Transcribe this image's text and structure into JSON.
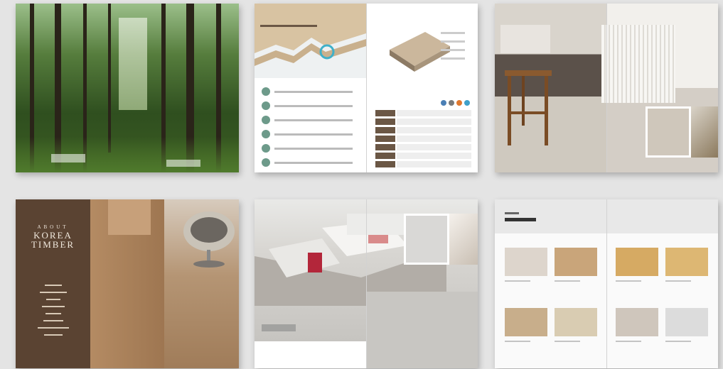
{
  "cover": {
    "brand": "KOREA TIMBER",
    "left_logo_text": "",
    "right_logo_text": ""
  },
  "spread2": {
    "left_label": "",
    "left_title": "",
    "list_items": [
      "",
      "",
      "",
      "",
      "",
      ""
    ],
    "right_label": "",
    "spec_rows": [
      "",
      "",
      "",
      "",
      "",
      "",
      ""
    ]
  },
  "spread3": {
    "label": ""
  },
  "about": {
    "heading_small": "ABOUT",
    "heading_line1": "KOREA",
    "heading_line2": "TIMBER",
    "menu": [
      "",
      "",
      "",
      "",
      "",
      "",
      "",
      ""
    ]
  },
  "spread5": {
    "label": "",
    "title": ""
  },
  "spread6": {
    "label": "",
    "title": "",
    "swatches": [
      {
        "color": "#ddd5cc",
        "caption": ""
      },
      {
        "color": "#c9a57a",
        "caption": ""
      },
      {
        "color": "#d6aa63",
        "caption": ""
      },
      {
        "color": "#ddb773",
        "caption": ""
      },
      {
        "color": "#c8ae8b",
        "caption": ""
      },
      {
        "color": "#d9ccb2",
        "caption": ""
      },
      {
        "color": "#cfc6bc",
        "caption": ""
      },
      {
        "color": "#dcdcdc",
        "caption": ""
      }
    ]
  },
  "colors": {
    "background": "#e4e4e4",
    "wood_dark": "#5a4332",
    "wood_light": "#c9a57a",
    "teal_accent": "#3fb0c9"
  }
}
